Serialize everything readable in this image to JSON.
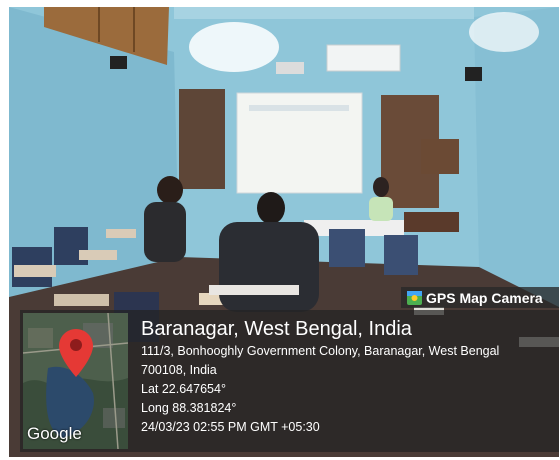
{
  "gps_badge": {
    "label": "GPS Map Camera"
  },
  "map": {
    "brand": "Google"
  },
  "location": {
    "title": "Baranagar, West Bengal, India",
    "address_line1": "111/3, Bonhooghly Government Colony, Baranagar, West Bengal",
    "address_line2": "700108, India",
    "latitude": "Lat 22.647654°",
    "longitude": "Long 88.381824°",
    "datetime": "24/03/23 02:55 PM GMT +05:30"
  },
  "colors": {
    "wall": "#8fc6d9",
    "floor": "#4a3b36",
    "pin": "#e53935",
    "water": "#2c4a6b"
  }
}
